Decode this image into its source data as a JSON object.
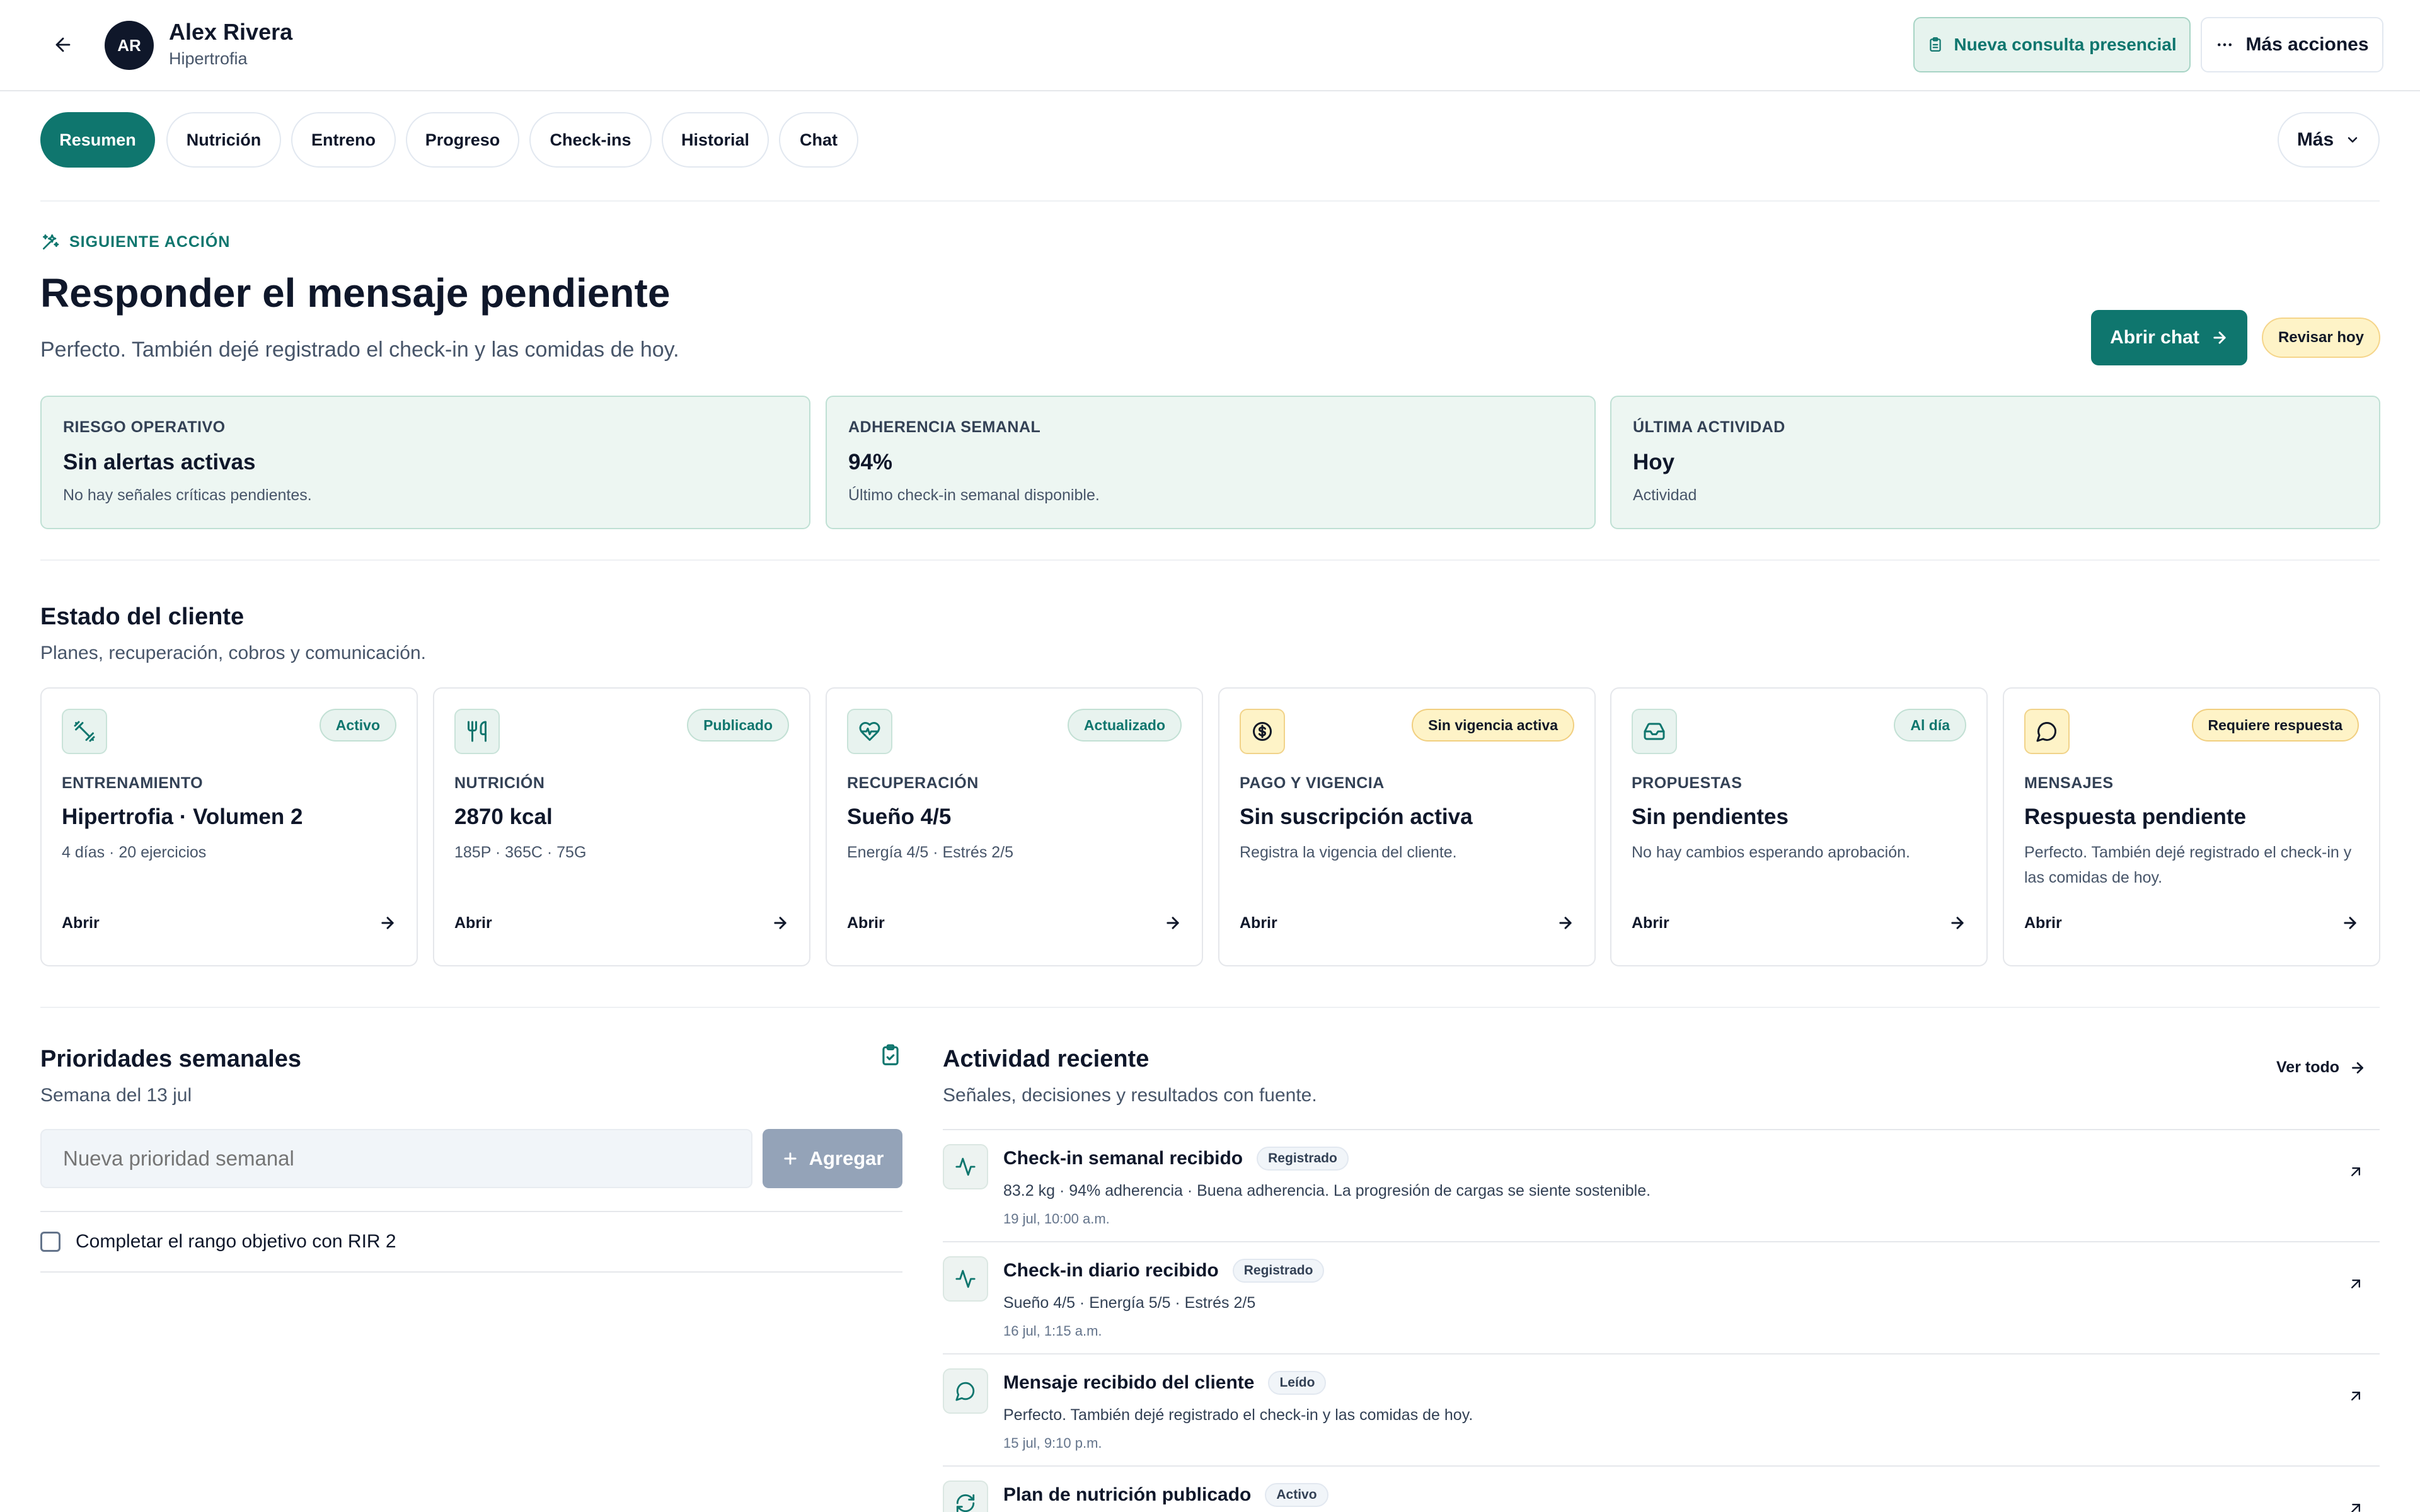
{
  "header": {
    "avatar_initials": "AR",
    "client_name": "Alex Rivera",
    "client_goal": "Hipertrofia",
    "new_consult_label": "Nueva consulta presencial",
    "more_actions_label": "Más acciones"
  },
  "tabs": [
    {
      "label": "Resumen",
      "active": true
    },
    {
      "label": "Nutrición"
    },
    {
      "label": "Entreno"
    },
    {
      "label": "Progreso"
    },
    {
      "label": "Check-ins"
    },
    {
      "label": "Historial"
    },
    {
      "label": "Chat"
    }
  ],
  "tabs_more_label": "Más",
  "next_action": {
    "eyebrow": "SIGUIENTE ACCIÓN",
    "title": "Responder el mensaje pendiente",
    "description": "Perfecto. También dejé registrado el check-in y las comidas de hoy.",
    "primary_label": "Abrir chat",
    "badge": "Revisar hoy"
  },
  "summary_cards": [
    {
      "label": "RIESGO OPERATIVO",
      "value": "Sin alertas activas",
      "desc": "No hay señales críticas pendientes."
    },
    {
      "label": "ADHERENCIA SEMANAL",
      "value": "94%",
      "desc": "Último check-in semanal disponible."
    },
    {
      "label": "ÚLTIMA ACTIVIDAD",
      "value": "Hoy",
      "desc": "Actividad"
    }
  ],
  "status_section": {
    "title": "Estado del cliente",
    "subtitle": "Planes, recuperación, cobros y comunicación.",
    "open_label": "Abrir",
    "cards": [
      {
        "icon": "dumbbell-icon",
        "badge": "Activo",
        "category": "ENTRENAMIENTO",
        "value": "Hipertrofia · Volumen 2",
        "desc": "4 días · 20 ejercicios"
      },
      {
        "icon": "utensils-icon",
        "badge": "Publicado",
        "category": "NUTRICIÓN",
        "value": "2870 kcal",
        "desc": "185P · 365C · 75G"
      },
      {
        "icon": "heart-pulse-icon",
        "badge": "Actualizado",
        "category": "RECUPERACIÓN",
        "value": "Sueño 4/5",
        "desc": "Energía 4/5 · Estrés 2/5"
      },
      {
        "icon": "dollar-circle-icon",
        "badge": "Sin vigencia activa",
        "category": "PAGO Y VIGENCIA",
        "value": "Sin suscripción activa",
        "desc": "Registra la vigencia del cliente."
      },
      {
        "icon": "inbox-icon",
        "badge": "Al día",
        "category": "PROPUESTAS",
        "value": "Sin pendientes",
        "desc": "No hay cambios esperando aprobación."
      },
      {
        "icon": "message-circle-icon",
        "badge": "Requiere respuesta",
        "category": "MENSAJES",
        "value": "Respuesta pendiente",
        "desc": "Perfecto. También dejé registrado el check-in y las comidas de hoy."
      }
    ]
  },
  "priorities": {
    "title": "Prioridades semanales",
    "week": "Semana del 13 jul",
    "input_placeholder": "Nueva prioridad semanal",
    "add_label": "Agregar",
    "items": [
      {
        "text": "Completar el rango objetivo con RIR 2",
        "checked": false
      }
    ]
  },
  "activity": {
    "title": "Actividad reciente",
    "subtitle": "Señales, decisiones y resultados con fuente.",
    "see_all_label": "Ver todo",
    "items": [
      {
        "icon": "activity-icon",
        "title": "Check-in semanal recibido",
        "badge": "Registrado",
        "desc": "83.2 kg · 94% adherencia · Buena adherencia. La progresión de cargas se siente sostenible.",
        "time": "19 jul, 10:00 a.m."
      },
      {
        "icon": "activity-icon",
        "title": "Check-in diario recibido",
        "badge": "Registrado",
        "desc": "Sueño 4/5 · Energía 5/5 · Estrés 2/5",
        "time": "16 jul, 1:15 a.m."
      },
      {
        "icon": "message-circle-icon",
        "title": "Mensaje recibido del cliente",
        "badge": "Leído",
        "desc": "Perfecto. También dejé registrado el check-in y las comidas de hoy.",
        "time": "15 jul, 9:10 p.m."
      },
      {
        "icon": "refresh-icon",
        "title": "Plan de nutrición publicado",
        "badge": "Activo",
        "desc": "",
        "time": ""
      }
    ]
  },
  "colors": {
    "primary": "#0f766e",
    "mint_bg": "#edf6f2",
    "warning_bg": "#fef3c7",
    "disabled": "#94a3b8"
  }
}
